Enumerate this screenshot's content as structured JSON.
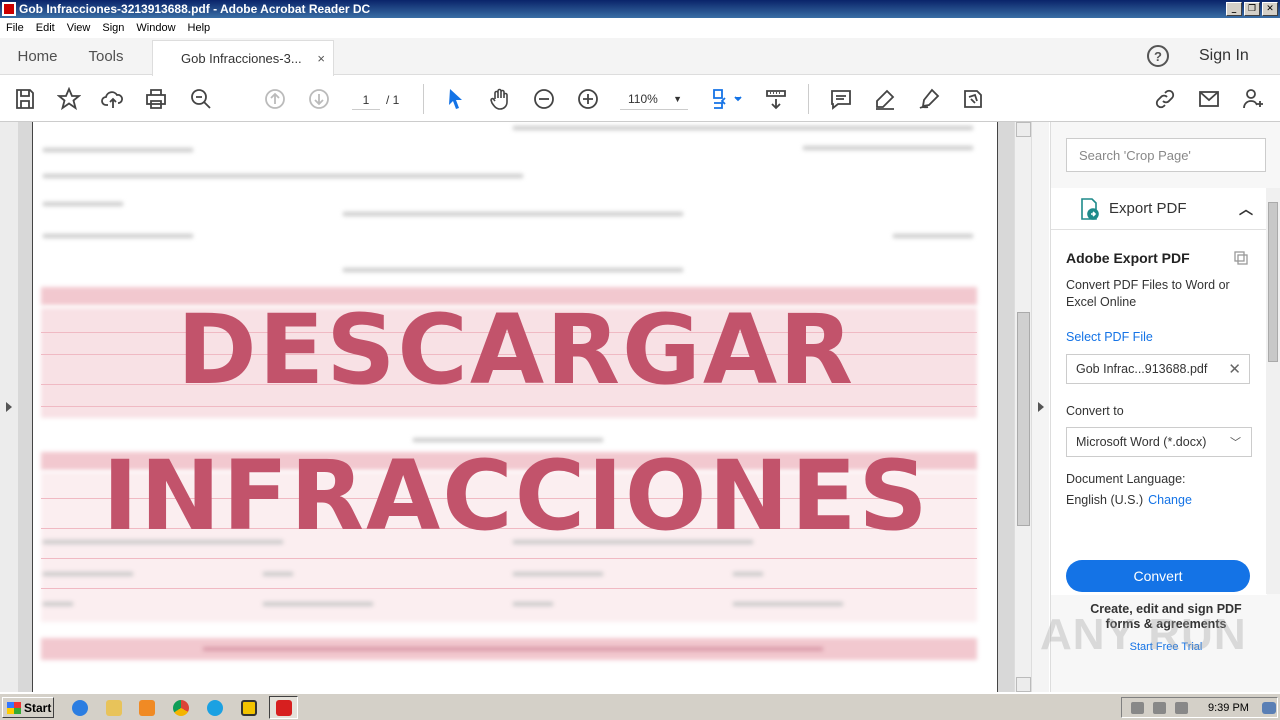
{
  "window": {
    "title": "Gob Infracciones-3213913688.pdf - Adobe Acrobat Reader DC",
    "buttons": [
      "_",
      "❐",
      "✕"
    ]
  },
  "menu": [
    "File",
    "Edit",
    "View",
    "Sign",
    "Window",
    "Help"
  ],
  "tabs": {
    "home": "Home",
    "tools": "Tools",
    "document": "Gob Infracciones-3...",
    "close": "×",
    "help": "?",
    "sign_in": "Sign In"
  },
  "toolbar": {
    "page_current": "1",
    "page_total": "/ 1",
    "zoom": "110%"
  },
  "document": {
    "overlay_line1": "DESCARGAR",
    "overlay_line2": "INFRACCIONES",
    "overlay_color": "#c2536b"
  },
  "panel": {
    "search_placeholder": "Search 'Crop Page'",
    "export_label": "Export PDF",
    "title": "Adobe Export PDF",
    "subtitle": "Convert PDF Files to Word or Excel Online",
    "select_pdf": "Select PDF File",
    "file_name": "Gob Infrac...913688.pdf",
    "convert_to_label": "Convert to",
    "convert_to_value": "Microsoft Word (*.docx)",
    "doc_lang_label": "Document Language:",
    "doc_lang_value": "English (U.S.)",
    "change": "Change",
    "convert_button": "Convert",
    "promo_text": "Create, edit and sign PDF forms & agreements",
    "promo_link": "Start Free Trial",
    "accent": "#1473e6"
  },
  "watermark": "ANY RUN",
  "taskbar": {
    "start": "Start",
    "clock": "9:39 PM"
  }
}
